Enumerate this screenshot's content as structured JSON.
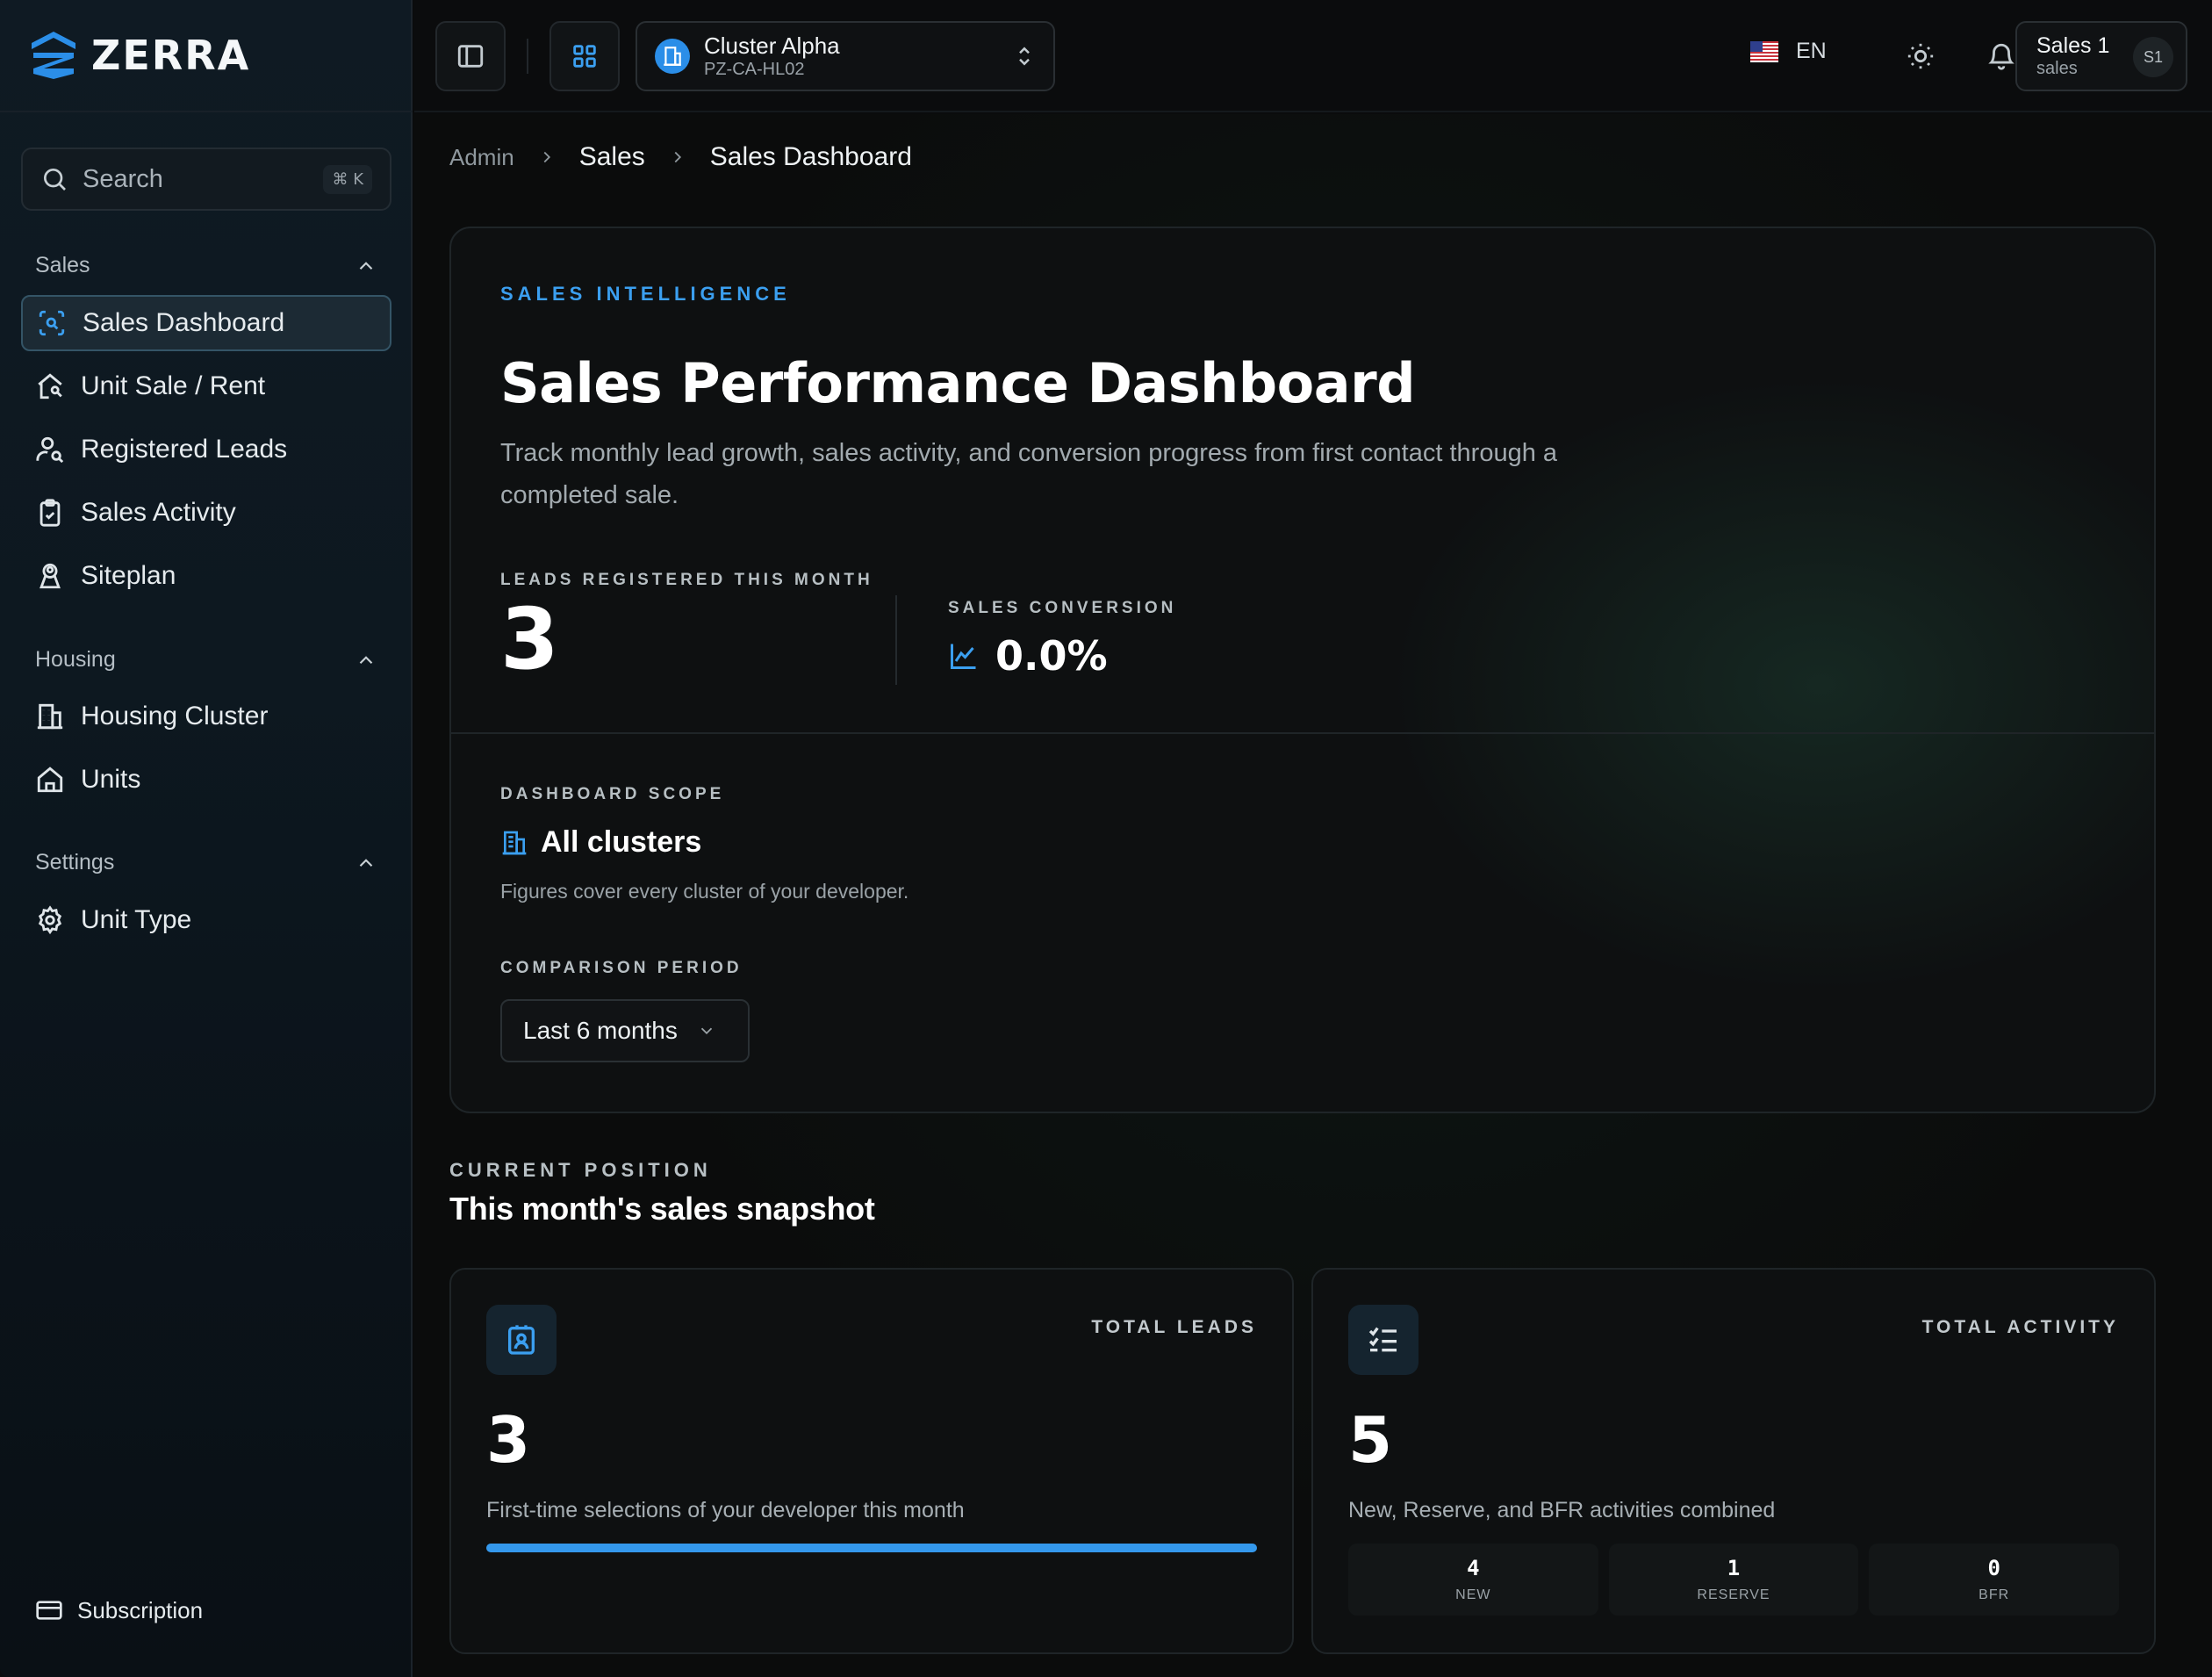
{
  "brand": {
    "name": "ZERRA",
    "accent": "#2b8ee8"
  },
  "sidebar": {
    "search": {
      "placeholder": "Search",
      "shortcut": "⌘ K"
    },
    "groups": [
      {
        "label": "Sales",
        "items": [
          {
            "label": "Sales Dashboard",
            "icon": "scan-search-icon",
            "active": true
          },
          {
            "label": "Unit Sale / Rent",
            "icon": "house-key-icon"
          },
          {
            "label": "Registered Leads",
            "icon": "user-search-icon"
          },
          {
            "label": "Sales Activity",
            "icon": "clipboard-check-icon"
          },
          {
            "label": "Siteplan",
            "icon": "map-pin-user-icon"
          }
        ]
      },
      {
        "label": "Housing",
        "items": [
          {
            "label": "Housing Cluster",
            "icon": "building-icon"
          },
          {
            "label": "Units",
            "icon": "home-icon"
          }
        ]
      },
      {
        "label": "Settings",
        "items": [
          {
            "label": "Unit Type",
            "icon": "gear-icon"
          }
        ]
      }
    ],
    "footer": {
      "label": "Subscription",
      "icon": "credit-card-icon"
    }
  },
  "topbar": {
    "cluster": {
      "name": "Cluster Alpha",
      "code": "PZ-CA-HL02"
    },
    "language": "EN",
    "user": {
      "name": "Sales 1",
      "role": "sales",
      "initials": "S1"
    }
  },
  "breadcrumb": [
    "Admin",
    "Sales",
    "Sales Dashboard"
  ],
  "hero": {
    "eyebrow": "SALES INTELLIGENCE",
    "title": "Sales Performance Dashboard",
    "description": "Track monthly lead growth, sales activity, and conversion progress from first contact through a completed sale.",
    "leads_label": "LEADS REGISTERED THIS MONTH",
    "leads_value": "3",
    "conversion_label": "SALES CONVERSION",
    "conversion_value": "0.0%",
    "scope_label": "DASHBOARD SCOPE",
    "scope_value": "All clusters",
    "scope_note": "Figures cover every cluster of your developer.",
    "period_label": "COMPARISON PERIOD",
    "period_value": "Last 6 months"
  },
  "snapshot": {
    "eyebrow": "CURRENT POSITION",
    "title": "This month's sales snapshot",
    "leads_card": {
      "label": "TOTAL LEADS",
      "value": "3",
      "description": "First-time selections of your developer this month",
      "progress": 1.0
    },
    "activity_card": {
      "label": "TOTAL ACTIVITY",
      "value": "5",
      "description": "New, Reserve, and BFR activities combined",
      "breakdown": [
        {
          "value": "4",
          "label": "NEW"
        },
        {
          "value": "1",
          "label": "RESERVE"
        },
        {
          "value": "0",
          "label": "BFR"
        }
      ]
    }
  }
}
